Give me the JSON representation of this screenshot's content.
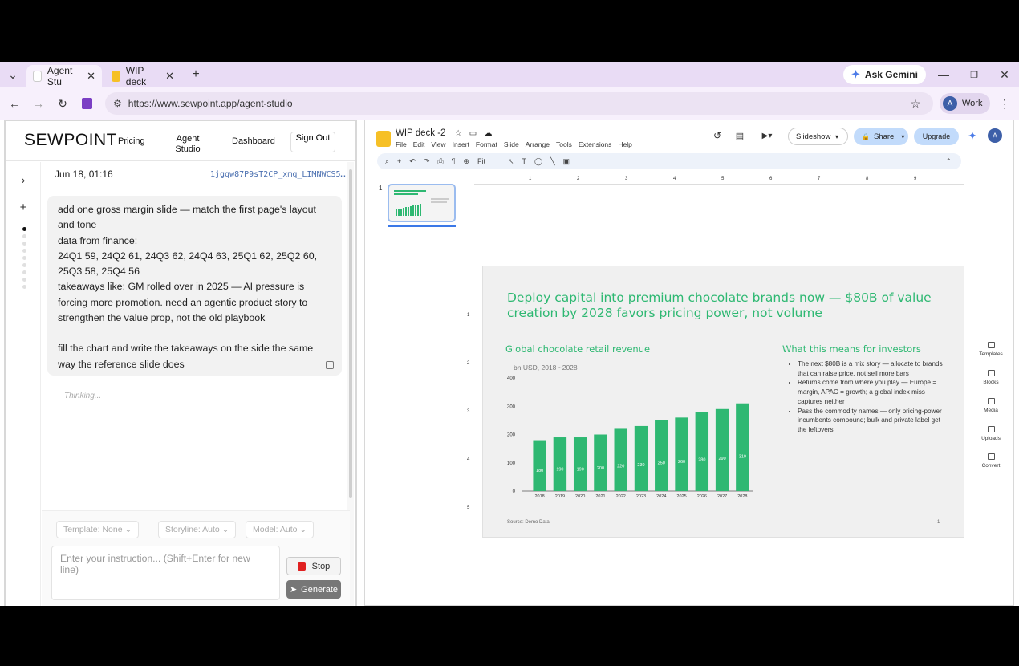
{
  "browser": {
    "tabs": [
      {
        "title": "Agent Stu",
        "active": true
      },
      {
        "title": "WIP deck",
        "active": false
      }
    ],
    "ask_gemini": "Ask Gemini",
    "url": "https://www.sewpoint.app/agent-studio",
    "profile": {
      "initial": "A",
      "label": "Work"
    }
  },
  "app": {
    "logo": "SEWPOINT",
    "nav": {
      "pricing": "Pricing",
      "agent_studio": "Agent Studio",
      "dashboard": "Dashboard",
      "sign_out": "Sign Out"
    },
    "session": {
      "date": "Jun 18, 01:16",
      "id": "1jgqw87P9sT2CP_xmq_LIMNWCS5…"
    },
    "message_lines": [
      "add one gross margin slide — match the first page's layout and tone",
      "data from finance:",
      "24Q1 59, 24Q2 61, 24Q3 62, 24Q4 63, 25Q1 62, 25Q2 60, 25Q3 58, 25Q4 56",
      "takeaways like: GM rolled over in 2025 — AI pressure is forcing more promotion. need an agentic product story to strengthen the value prop, not the old playbook",
      "",
      "fill the chart and write the takeaways on the side the same way the reference slide does"
    ],
    "thinking": "Thinking...",
    "composer": {
      "template": "Template: None",
      "storyline": "Storyline: Auto",
      "model": "Model: Auto",
      "placeholder": "Enter your instruction... (Shift+Enter for new line)",
      "stop": "Stop",
      "generate": "Generate"
    }
  },
  "slides": {
    "doc_title": "WIP deck -2",
    "menus": [
      "File",
      "Edit",
      "View",
      "Insert",
      "Format",
      "Slide",
      "Arrange",
      "Tools",
      "Extensions",
      "Help"
    ],
    "slideshow": "Slideshow",
    "share": "Share",
    "upgrade": "Upgrade",
    "account_initial": "A",
    "zoom": "Fit",
    "slide_number": "1",
    "right_tools": [
      "Templates",
      "Blocks",
      "Media",
      "Uploads",
      "Convert"
    ]
  },
  "slide": {
    "title": "Deploy capital into premium chocolate brands now — $80B of value creation by 2028 favors pricing power, not volume",
    "chart_heading": "Global chocolate retail revenue",
    "chart_subtitle": "bn USD, 2018 ~2028",
    "side_heading": "What this means for investors",
    "bullets": [
      "The next $80B is a mix story — allocate to brands that can raise price, not sell more bars",
      "Returns come from where you play — Europe = margin, APAC = growth; a global index miss captures neither",
      "Pass the commodity names — only pricing-power incumbents compound; bulk and private label get the leftovers"
    ],
    "source": "Source: Demo Data",
    "page": "1"
  },
  "chart_data": {
    "type": "bar",
    "title": "Global chocolate retail revenue",
    "subtitle": "bn USD, 2018 ~2028",
    "categories": [
      "2018",
      "2019",
      "2020",
      "2021",
      "2022",
      "2023",
      "2024",
      "2025",
      "2026",
      "2027",
      "2028"
    ],
    "values": [
      180,
      190,
      190,
      200,
      220,
      230,
      250,
      260,
      280,
      290,
      310
    ],
    "ylim": [
      0,
      400
    ],
    "yticks": [
      0,
      100,
      200,
      300,
      400
    ],
    "color": "#2eb872"
  }
}
